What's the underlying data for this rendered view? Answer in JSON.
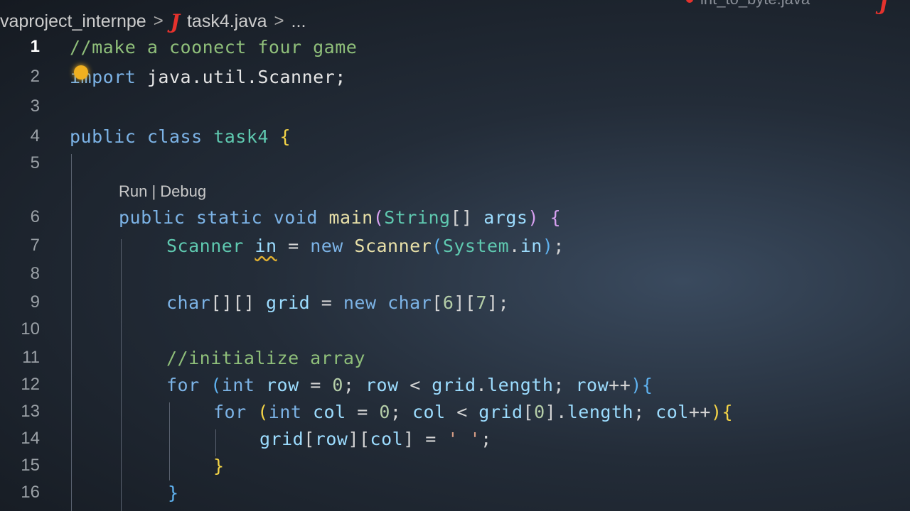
{
  "breadcrumb": {
    "project": "vaproject_internpe",
    "separator": ">",
    "file": "task4.java",
    "more": "..."
  },
  "tabs": {
    "other_file": "int_to_byte.java"
  },
  "codelens": "Run | Debug",
  "lines": {
    "n1": "1",
    "n2": "2",
    "n3": "3",
    "n4": "4",
    "n5": "5",
    "n6": "6",
    "n7": "7",
    "n8": "8",
    "n9": "9",
    "n10": "10",
    "n11": "11",
    "n12": "12",
    "n13": "13",
    "n14": "14",
    "n15": "15",
    "n16": "16",
    "c1": "//make a coonect four game",
    "c11": "//initialize array"
  },
  "colors": {
    "comment": "#8fbf7a",
    "keyword": "#7cb3e6",
    "type": "#5fc9b0",
    "java_icon": "#e5322d"
  }
}
